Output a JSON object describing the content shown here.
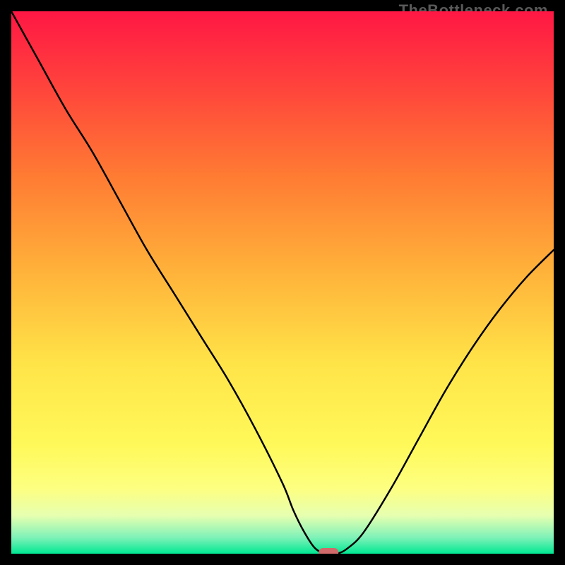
{
  "watermark": "TheBottleneck.com",
  "chart_data": {
    "type": "line",
    "x": [
      0.0,
      0.05,
      0.1,
      0.15,
      0.2,
      0.25,
      0.3,
      0.35,
      0.4,
      0.45,
      0.5,
      0.52,
      0.54,
      0.56,
      0.58,
      0.6,
      0.62,
      0.65,
      0.7,
      0.75,
      0.8,
      0.85,
      0.9,
      0.95,
      1.0
    ],
    "y": [
      1.0,
      0.91,
      0.82,
      0.74,
      0.65,
      0.56,
      0.48,
      0.4,
      0.32,
      0.23,
      0.13,
      0.08,
      0.04,
      0.01,
      0.0,
      0.0,
      0.01,
      0.04,
      0.12,
      0.21,
      0.3,
      0.38,
      0.45,
      0.51,
      0.56
    ],
    "title": "",
    "xlabel": "",
    "ylabel": "",
    "xlim": [
      0,
      1
    ],
    "ylim": [
      0,
      1
    ],
    "gradient_stops": [
      {
        "offset": 0.0,
        "color": "#ff1744"
      },
      {
        "offset": 0.12,
        "color": "#ff3d3d"
      },
      {
        "offset": 0.3,
        "color": "#ff7a33"
      },
      {
        "offset": 0.48,
        "color": "#ffb23a"
      },
      {
        "offset": 0.65,
        "color": "#ffe448"
      },
      {
        "offset": 0.8,
        "color": "#fff95a"
      },
      {
        "offset": 0.88,
        "color": "#fdff81"
      },
      {
        "offset": 0.93,
        "color": "#e6ffb0"
      },
      {
        "offset": 0.97,
        "color": "#7ff2b8"
      },
      {
        "offset": 1.0,
        "color": "#00e893"
      }
    ],
    "marker": {
      "x": 0.585,
      "y": 0.0,
      "color": "#d16a6a"
    }
  }
}
